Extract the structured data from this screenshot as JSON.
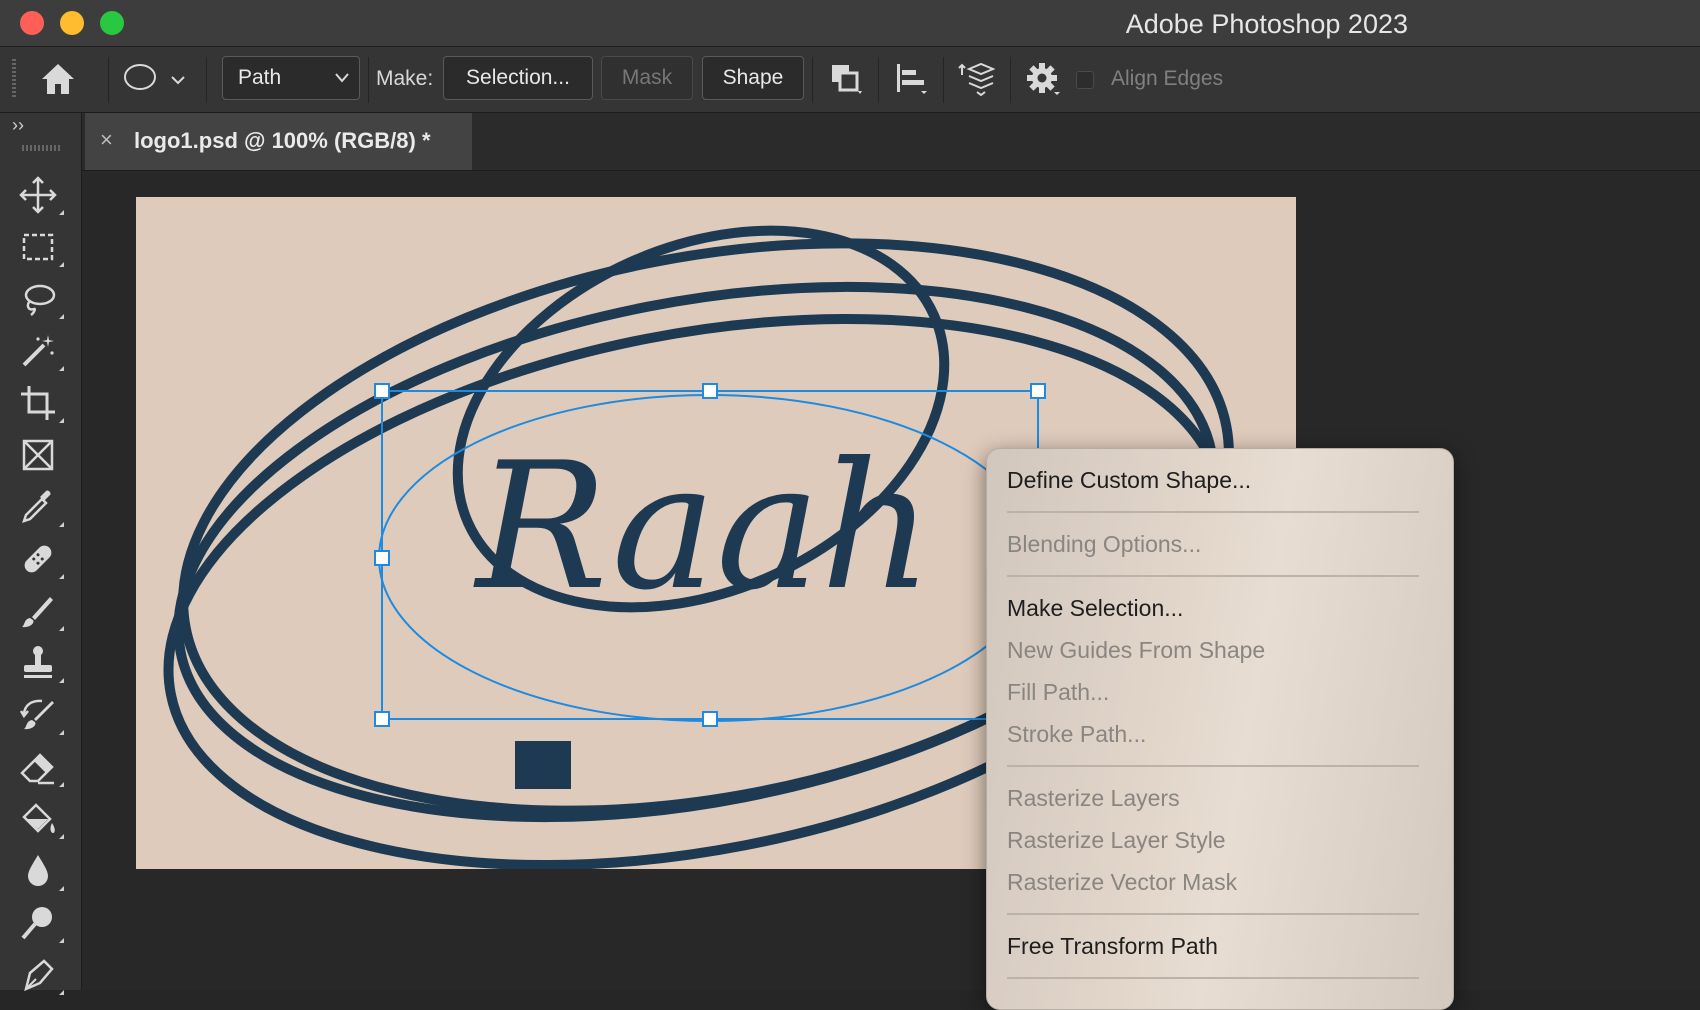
{
  "window": {
    "title": "Adobe Photoshop 2023"
  },
  "options_bar": {
    "tool_icon": "ellipse-tool-icon",
    "mode_select": "Path",
    "make_label": "Make:",
    "selection_button": "Selection...",
    "mask_button": "Mask",
    "shape_button": "Shape",
    "align_edges_label": "Align Edges",
    "align_edges_checked": false
  },
  "document_tab": {
    "close_glyph": "×",
    "label": "logo1.psd @ 100% (RGB/8) *"
  },
  "panel_toggle": "››",
  "canvas": {
    "logo_text": "Raah",
    "background_color": "#dfcbbb",
    "ink_color": "#1d3a52",
    "path_color": "#1e8ae0"
  },
  "tools": [
    "move-tool-icon",
    "rectangular-marquee-icon",
    "lasso-icon",
    "magic-wand-icon",
    "crop-icon",
    "frame-icon",
    "eyedropper-icon",
    "healing-brush-icon",
    "brush-icon",
    "clone-stamp-icon",
    "history-brush-icon",
    "eraser-icon",
    "paint-bucket-icon",
    "blur-icon",
    "dodge-icon",
    "pen-icon"
  ],
  "context_menu": {
    "items": [
      {
        "label": "Define Custom Shape...",
        "enabled": true
      },
      {
        "label": "Blending Options...",
        "enabled": false
      },
      {
        "label": "Make Selection...",
        "enabled": true
      },
      {
        "label": "New Guides From Shape",
        "enabled": false
      },
      {
        "label": "Fill Path...",
        "enabled": false
      },
      {
        "label": "Stroke Path...",
        "enabled": false
      },
      {
        "label": "Rasterize Layers",
        "enabled": false
      },
      {
        "label": "Rasterize Layer Style",
        "enabled": false
      },
      {
        "label": "Rasterize Vector Mask",
        "enabled": false
      },
      {
        "label": "Free Transform Path",
        "enabled": true
      }
    ]
  }
}
